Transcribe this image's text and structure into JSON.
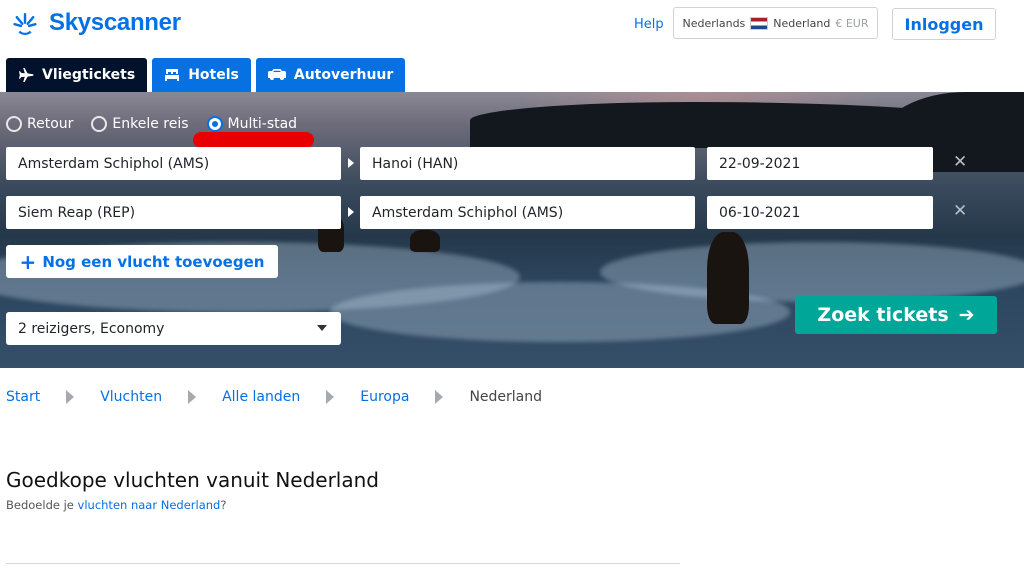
{
  "brand": {
    "name": "Skyscanner",
    "color": "#0770e3"
  },
  "header": {
    "help": "Help",
    "locale": {
      "language": "Nederlands",
      "country": "Nederland",
      "currency": "€ EUR",
      "flag_icon": "netherlands-flag-icon"
    },
    "login": "Inloggen"
  },
  "tabs": [
    {
      "label": "Vliegtickets",
      "icon": "plane-icon",
      "active": true
    },
    {
      "label": "Hotels",
      "icon": "bed-icon",
      "active": false
    },
    {
      "label": "Autoverhuur",
      "icon": "car-icon",
      "active": false
    }
  ],
  "search": {
    "trip_types": [
      {
        "label": "Retour",
        "selected": false
      },
      {
        "label": "Enkele reis",
        "selected": false
      },
      {
        "label": "Multi-stad",
        "selected": true
      }
    ],
    "legs": [
      {
        "from": "Amsterdam Schiphol (AMS)",
        "to": "Hanoi (HAN)",
        "date": "22-09-2021"
      },
      {
        "from": "Siem Reap (REP)",
        "to": "Amsterdam Schiphol (AMS)",
        "date": "06-10-2021"
      }
    ],
    "remove_glyph": "✕",
    "add_flight": "Nog een vlucht toevoegen",
    "add_glyph": "+",
    "travellers": "2 reizigers, Economy",
    "submit": "Zoek tickets",
    "submit_glyph": "➔",
    "submit_color": "#00a698"
  },
  "breadcrumb": [
    "Start",
    "Vluchten",
    "Alle landen",
    "Europa",
    "Nederland"
  ],
  "page": {
    "title": "Goedkope vluchten vanuit Nederland",
    "subtitle_prefix": "Bedoelde je",
    "subtitle_link": "vluchten naar Nederland",
    "subtitle_suffix": "?"
  },
  "annotation": {
    "color": "#e80000"
  }
}
